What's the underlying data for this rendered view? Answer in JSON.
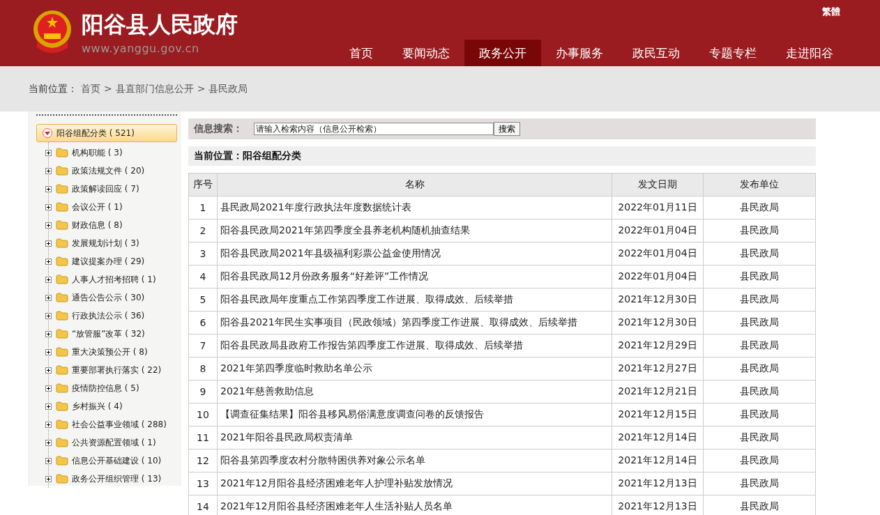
{
  "header": {
    "site_title": "阳谷县人民政府",
    "site_url": "www.yanggu.gov.cn",
    "lang_link": "繁體"
  },
  "nav": [
    {
      "label": "首页",
      "selected": false
    },
    {
      "label": "要闻动态",
      "selected": false
    },
    {
      "label": "政务公开",
      "selected": true
    },
    {
      "label": "办事服务",
      "selected": false
    },
    {
      "label": "政民互动",
      "selected": false
    },
    {
      "label": "专题专栏",
      "selected": false
    },
    {
      "label": "走进阳谷",
      "selected": false
    }
  ],
  "breadcrumb": {
    "label": "当前位置：",
    "separator": ">",
    "items": [
      "首页",
      "县直部门信息公开",
      "县民政局"
    ]
  },
  "sidebar": {
    "tree": [
      {
        "label": "阳谷组配分类 ( 521)",
        "expanded": true,
        "children": [
          {
            "label": "机构职能 ( 3)",
            "expanded": false
          },
          {
            "label": "政策法规文件 ( 20)",
            "expanded": false
          },
          {
            "label": "政策解读回应 ( 7)",
            "expanded": false
          },
          {
            "label": "会议公开 ( 1)",
            "expanded": false
          },
          {
            "label": "财政信息 ( 8)",
            "expanded": false
          },
          {
            "label": "发展规划计划 ( 3)",
            "expanded": false
          },
          {
            "label": "建议提案办理 ( 29)",
            "expanded": false
          },
          {
            "label": "人事人才招考招聘 ( 1)",
            "expanded": false
          },
          {
            "label": "通告公告公示 ( 30)",
            "expanded": false
          },
          {
            "label": "行政执法公示 ( 36)",
            "expanded": false
          },
          {
            "label": "“放管服”改革 ( 32)",
            "expanded": false
          },
          {
            "label": "重大决策预公开 ( 8)",
            "expanded": false
          },
          {
            "label": "重要部署执行落实 ( 22)",
            "expanded": false
          },
          {
            "label": "疫情防控信息 ( 5)",
            "expanded": false
          },
          {
            "label": "乡村振兴 ( 4)",
            "expanded": false
          },
          {
            "label": "社会公益事业领域 ( 288)",
            "expanded": false
          },
          {
            "label": "公共资源配置领域 ( 1)",
            "expanded": false
          },
          {
            "label": "信息公开基础建设 ( 10)",
            "expanded": false
          },
          {
            "label": "政务公开组织管理 ( 13)",
            "expanded": false
          }
        ]
      }
    ]
  },
  "search": {
    "label": "信息搜索：",
    "value": "请输入检索内容（信息公开检索）",
    "button": "搜索"
  },
  "current_location": "当前位置：阳谷组配分类",
  "table": {
    "columns": [
      "序号",
      "名称",
      "发文日期",
      "发布单位"
    ],
    "rows": [
      [
        "1",
        "县民政局2021年度行政执法年度数据统计表",
        "2022年01月11日",
        "县民政局"
      ],
      [
        "2",
        "阳谷县民政局2021年第四季度全县养老机构随机抽查结果",
        "2022年01月04日",
        "县民政局"
      ],
      [
        "3",
        "阳谷县民政局2021年县级福利彩票公益金使用情况",
        "2022年01月04日",
        "县民政局"
      ],
      [
        "4",
        "阳谷县民政局12月份政务服务“好差评”工作情况",
        "2022年01月04日",
        "县民政局"
      ],
      [
        "5",
        "阳谷县民政局年度重点工作第四季度工作进展、取得成效、后续举措",
        "2021年12月30日",
        "县民政局"
      ],
      [
        "6",
        "阳谷县2021年民生实事项目（民政领域）第四季度工作进展、取得成效、后续举措",
        "2021年12月30日",
        "县民政局"
      ],
      [
        "7",
        "阳谷县民政局县政府工作报告第四季度工作进展、取得成效、后续举措",
        "2021年12月29日",
        "县民政局"
      ],
      [
        "8",
        "2021年第四季度临时救助名单公示",
        "2021年12月27日",
        "县民政局"
      ],
      [
        "9",
        "2021年慈善救助信息",
        "2021年12月21日",
        "县民政局"
      ],
      [
        "10",
        "【调查征集结果】阳谷县移风易俗满意度调查问卷的反馈报告",
        "2021年12月15日",
        "县民政局"
      ],
      [
        "11",
        "2021年阳谷县民政局权责清单",
        "2021年12月14日",
        "县民政局"
      ],
      [
        "12",
        "阳谷县第四季度农村分散特困供养对象公示名单",
        "2021年12月14日",
        "县民政局"
      ],
      [
        "13",
        "2021年12月阳谷县经济困难老年人护理补贴发放情况",
        "2021年12月13日",
        "县民政局"
      ],
      [
        "14",
        "2021年12月阳谷县经济困难老年人生活补贴人员名单",
        "2021年12月13日",
        "县民政局"
      ]
    ]
  }
}
